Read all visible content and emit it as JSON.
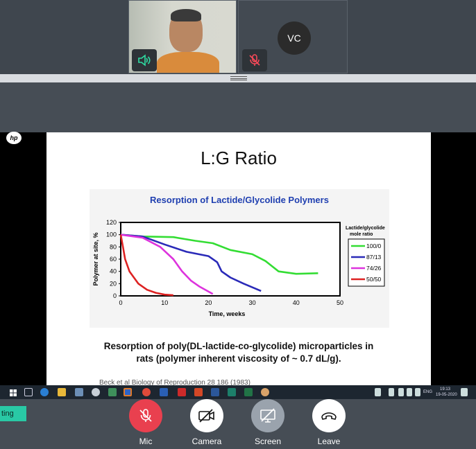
{
  "participants": {
    "vc_initials": "VC"
  },
  "slide": {
    "title": "L:G Ratio",
    "caption_line1": "Resorption of poly(DL-lactide-co-glycolide) microparticles in",
    "caption_line2": "rats (polymer inherent viscosity of ~ 0.7 dL/g).",
    "reference": "Beck et al Biology of Reproduction 28 186 (1983)"
  },
  "chart_data": {
    "type": "line",
    "title": "Resorption of Lactide/Glycolide Polymers",
    "xlabel": "Time, weeks",
    "ylabel": "Polymer at site, %",
    "xlim": [
      0,
      50
    ],
    "ylim": [
      0,
      120
    ],
    "xticks": [
      0,
      10,
      20,
      30,
      40,
      50
    ],
    "yticks": [
      0,
      20,
      40,
      60,
      80,
      100,
      120
    ],
    "legend_title": "Lactide/glycolide mole ratio",
    "legend_position": "right",
    "grid": false,
    "series": [
      {
        "name": "100/0",
        "color": "#33dd33",
        "x": [
          0,
          5,
          12,
          17,
          21,
          25,
          30,
          33,
          36,
          40,
          45
        ],
        "y": [
          100,
          97,
          96,
          90,
          86,
          75,
          68,
          57,
          40,
          36,
          37
        ]
      },
      {
        "name": "87/13",
        "color": "#2a2ab8",
        "x": [
          0,
          5,
          10,
          15,
          20,
          22,
          23,
          25,
          28,
          32
        ],
        "y": [
          100,
          97,
          84,
          72,
          65,
          55,
          40,
          30,
          20,
          8
        ]
      },
      {
        "name": "74/26",
        "color": "#dd33dd",
        "x": [
          0,
          5,
          9,
          12,
          14,
          16,
          18,
          21
        ],
        "y": [
          100,
          95,
          80,
          60,
          40,
          25,
          15,
          3
        ]
      },
      {
        "name": "50/50",
        "color": "#dd2222",
        "x": [
          0,
          0.5,
          1,
          2,
          4,
          6,
          8,
          10,
          12
        ],
        "y": [
          100,
          80,
          60,
          40,
          20,
          10,
          5,
          2,
          1
        ]
      }
    ]
  },
  "taskbar": {
    "lang": "ENG",
    "time": "19:13",
    "date": "19-05-2020"
  },
  "controls": {
    "mic": "Mic",
    "camera": "Camera",
    "screen": "Screen",
    "leave": "Leave",
    "status_tag": "ting"
  }
}
